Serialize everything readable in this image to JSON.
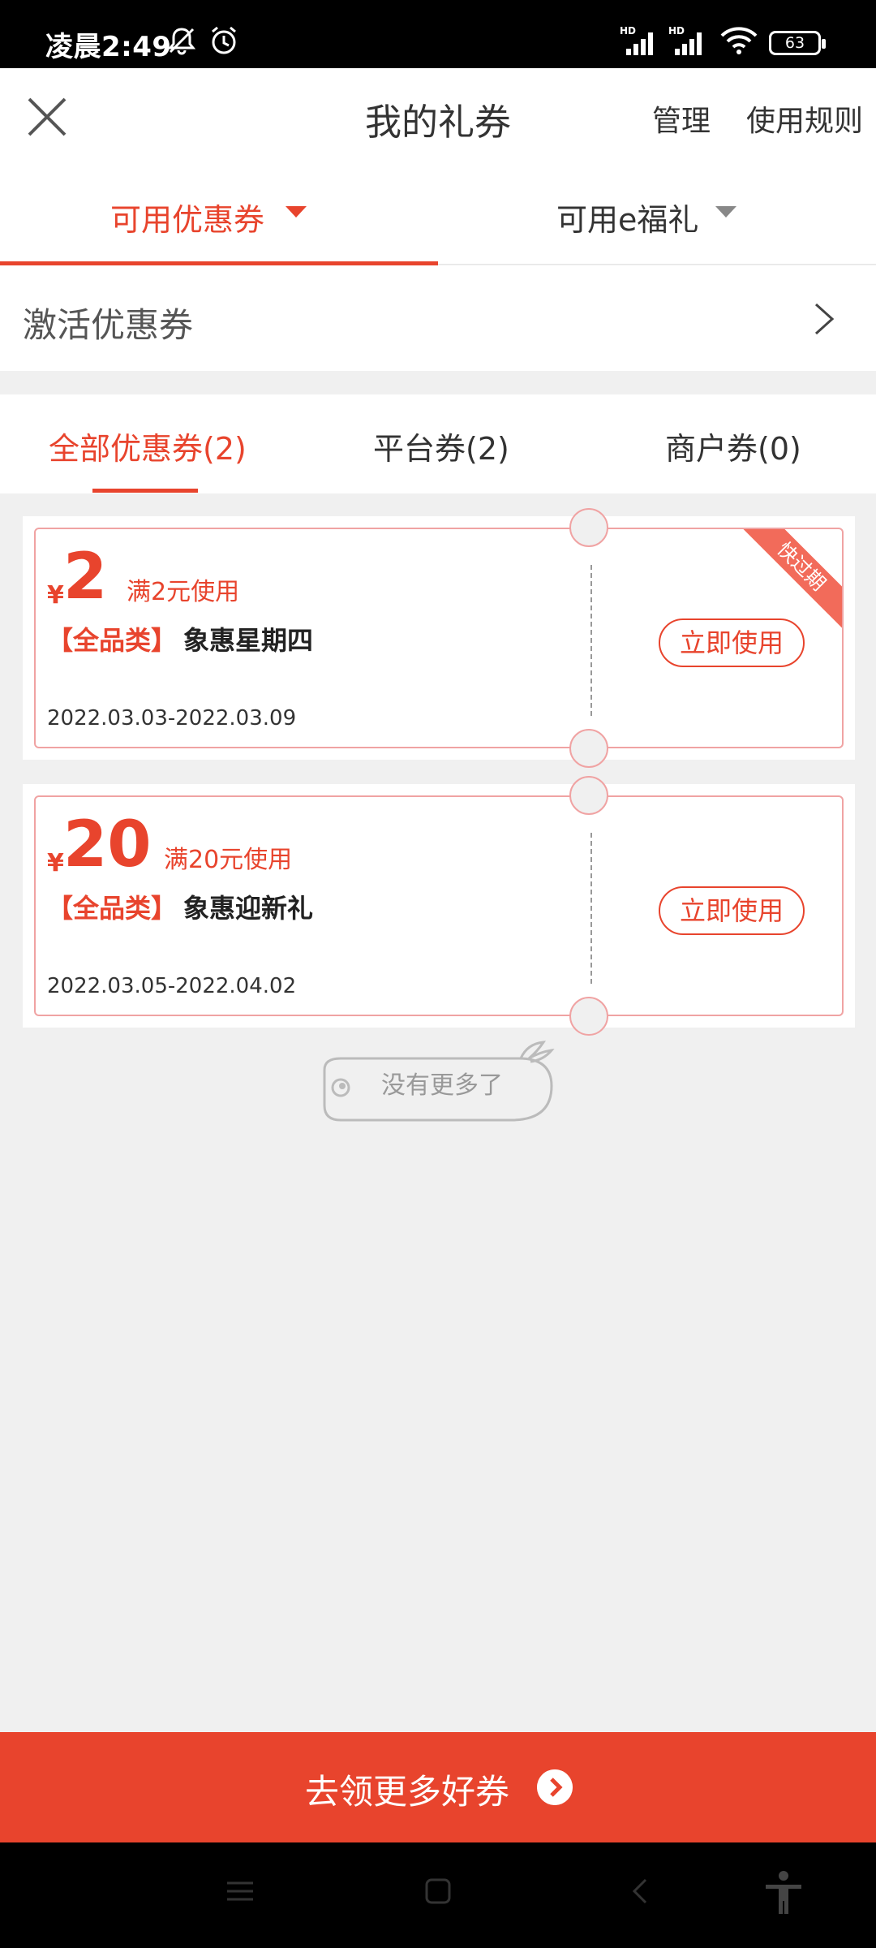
{
  "status_bar": {
    "time": "凌晨2:49",
    "battery": "63",
    "icons": [
      "mute-bell-icon",
      "alarm-icon",
      "hd-signal-icon",
      "hd-signal-icon",
      "wifi-icon",
      "battery-icon"
    ]
  },
  "header": {
    "title": "我的礼券",
    "manage": "管理",
    "rules": "使用规则",
    "close_icon": "close-icon"
  },
  "main_tabs": [
    {
      "label": "可用优惠券",
      "active": true
    },
    {
      "label": "可用e福礼",
      "active": false
    }
  ],
  "activate": {
    "label": "激活优惠券"
  },
  "filter_tabs": [
    {
      "label": "全部优惠券(2)",
      "active": true
    },
    {
      "label": "平台券(2)",
      "active": false
    },
    {
      "label": "商户券(0)",
      "active": false
    }
  ],
  "coupons": [
    {
      "currency": "¥",
      "amount": "2",
      "condition": "满2元使用",
      "category": "【全品类】",
      "name": "象惠星期四",
      "dates": "2022.03.03-2022.03.09",
      "button": "立即使用",
      "ribbon": "快过期"
    },
    {
      "currency": "¥",
      "amount": "20",
      "condition": "满20元使用",
      "category": "【全品类】",
      "name": "象惠迎新礼",
      "dates": "2022.03.05-2022.04.02",
      "button": "立即使用"
    }
  ],
  "no_more": "没有更多了",
  "cta": {
    "label": "去领更多好券"
  },
  "colors": {
    "accent": "#e8442d",
    "coupon_border": "#f0a3a3",
    "background": "#f0f0f0"
  },
  "navbar_icons": [
    "menu-icon",
    "home-icon",
    "back-icon",
    "accessibility-icon"
  ]
}
